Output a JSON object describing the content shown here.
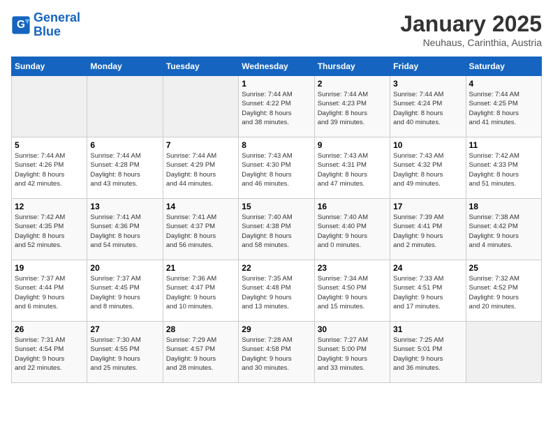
{
  "header": {
    "logo_line1": "General",
    "logo_line2": "Blue",
    "month": "January 2025",
    "location": "Neuhaus, Carinthia, Austria"
  },
  "days_of_week": [
    "Sunday",
    "Monday",
    "Tuesday",
    "Wednesday",
    "Thursday",
    "Friday",
    "Saturday"
  ],
  "weeks": [
    [
      {
        "day": "",
        "info": ""
      },
      {
        "day": "",
        "info": ""
      },
      {
        "day": "",
        "info": ""
      },
      {
        "day": "1",
        "info": "Sunrise: 7:44 AM\nSunset: 4:22 PM\nDaylight: 8 hours\nand 38 minutes."
      },
      {
        "day": "2",
        "info": "Sunrise: 7:44 AM\nSunset: 4:23 PM\nDaylight: 8 hours\nand 39 minutes."
      },
      {
        "day": "3",
        "info": "Sunrise: 7:44 AM\nSunset: 4:24 PM\nDaylight: 8 hours\nand 40 minutes."
      },
      {
        "day": "4",
        "info": "Sunrise: 7:44 AM\nSunset: 4:25 PM\nDaylight: 8 hours\nand 41 minutes."
      }
    ],
    [
      {
        "day": "5",
        "info": "Sunrise: 7:44 AM\nSunset: 4:26 PM\nDaylight: 8 hours\nand 42 minutes."
      },
      {
        "day": "6",
        "info": "Sunrise: 7:44 AM\nSunset: 4:28 PM\nDaylight: 8 hours\nand 43 minutes."
      },
      {
        "day": "7",
        "info": "Sunrise: 7:44 AM\nSunset: 4:29 PM\nDaylight: 8 hours\nand 44 minutes."
      },
      {
        "day": "8",
        "info": "Sunrise: 7:43 AM\nSunset: 4:30 PM\nDaylight: 8 hours\nand 46 minutes."
      },
      {
        "day": "9",
        "info": "Sunrise: 7:43 AM\nSunset: 4:31 PM\nDaylight: 8 hours\nand 47 minutes."
      },
      {
        "day": "10",
        "info": "Sunrise: 7:43 AM\nSunset: 4:32 PM\nDaylight: 8 hours\nand 49 minutes."
      },
      {
        "day": "11",
        "info": "Sunrise: 7:42 AM\nSunset: 4:33 PM\nDaylight: 8 hours\nand 51 minutes."
      }
    ],
    [
      {
        "day": "12",
        "info": "Sunrise: 7:42 AM\nSunset: 4:35 PM\nDaylight: 8 hours\nand 52 minutes."
      },
      {
        "day": "13",
        "info": "Sunrise: 7:41 AM\nSunset: 4:36 PM\nDaylight: 8 hours\nand 54 minutes."
      },
      {
        "day": "14",
        "info": "Sunrise: 7:41 AM\nSunset: 4:37 PM\nDaylight: 8 hours\nand 56 minutes."
      },
      {
        "day": "15",
        "info": "Sunrise: 7:40 AM\nSunset: 4:38 PM\nDaylight: 8 hours\nand 58 minutes."
      },
      {
        "day": "16",
        "info": "Sunrise: 7:40 AM\nSunset: 4:40 PM\nDaylight: 9 hours\nand 0 minutes."
      },
      {
        "day": "17",
        "info": "Sunrise: 7:39 AM\nSunset: 4:41 PM\nDaylight: 9 hours\nand 2 minutes."
      },
      {
        "day": "18",
        "info": "Sunrise: 7:38 AM\nSunset: 4:42 PM\nDaylight: 9 hours\nand 4 minutes."
      }
    ],
    [
      {
        "day": "19",
        "info": "Sunrise: 7:37 AM\nSunset: 4:44 PM\nDaylight: 9 hours\nand 6 minutes."
      },
      {
        "day": "20",
        "info": "Sunrise: 7:37 AM\nSunset: 4:45 PM\nDaylight: 9 hours\nand 8 minutes."
      },
      {
        "day": "21",
        "info": "Sunrise: 7:36 AM\nSunset: 4:47 PM\nDaylight: 9 hours\nand 10 minutes."
      },
      {
        "day": "22",
        "info": "Sunrise: 7:35 AM\nSunset: 4:48 PM\nDaylight: 9 hours\nand 13 minutes."
      },
      {
        "day": "23",
        "info": "Sunrise: 7:34 AM\nSunset: 4:50 PM\nDaylight: 9 hours\nand 15 minutes."
      },
      {
        "day": "24",
        "info": "Sunrise: 7:33 AM\nSunset: 4:51 PM\nDaylight: 9 hours\nand 17 minutes."
      },
      {
        "day": "25",
        "info": "Sunrise: 7:32 AM\nSunset: 4:52 PM\nDaylight: 9 hours\nand 20 minutes."
      }
    ],
    [
      {
        "day": "26",
        "info": "Sunrise: 7:31 AM\nSunset: 4:54 PM\nDaylight: 9 hours\nand 22 minutes."
      },
      {
        "day": "27",
        "info": "Sunrise: 7:30 AM\nSunset: 4:55 PM\nDaylight: 9 hours\nand 25 minutes."
      },
      {
        "day": "28",
        "info": "Sunrise: 7:29 AM\nSunset: 4:57 PM\nDaylight: 9 hours\nand 28 minutes."
      },
      {
        "day": "29",
        "info": "Sunrise: 7:28 AM\nSunset: 4:58 PM\nDaylight: 9 hours\nand 30 minutes."
      },
      {
        "day": "30",
        "info": "Sunrise: 7:27 AM\nSunset: 5:00 PM\nDaylight: 9 hours\nand 33 minutes."
      },
      {
        "day": "31",
        "info": "Sunrise: 7:25 AM\nSunset: 5:01 PM\nDaylight: 9 hours\nand 36 minutes."
      },
      {
        "day": "",
        "info": ""
      }
    ]
  ]
}
